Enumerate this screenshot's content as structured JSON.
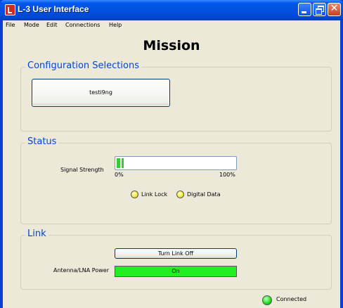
{
  "window": {
    "title": "L-3 User Interface"
  },
  "menu": {
    "file": "File",
    "mode": "Mode",
    "edit": "Edit",
    "connections": "Connections",
    "help": "Help"
  },
  "main": {
    "heading": "Mission"
  },
  "config": {
    "title": "Configuration Selections",
    "button_label": "testi9ng"
  },
  "status": {
    "title": "Status",
    "signal_label": "Signal Strength",
    "signal_level_fraction": 0.06,
    "min_label": "0%",
    "max_label": "100%",
    "link_lock_label": "Link Lock",
    "digital_data_label": "Digital Data",
    "indicator_color": "#f5ea28"
  },
  "link": {
    "title": "Link",
    "toggle_label": "Turn Link Off",
    "power_label": "Antenna/LNA Power",
    "power_value": "On",
    "power_color": "#22ee22"
  },
  "footer": {
    "connection_status": "Connected",
    "status_color": "#12e012"
  },
  "colors": {
    "group_title": "#0046d5",
    "titlebar": "#0350e0",
    "close_button": "#c8401c"
  }
}
